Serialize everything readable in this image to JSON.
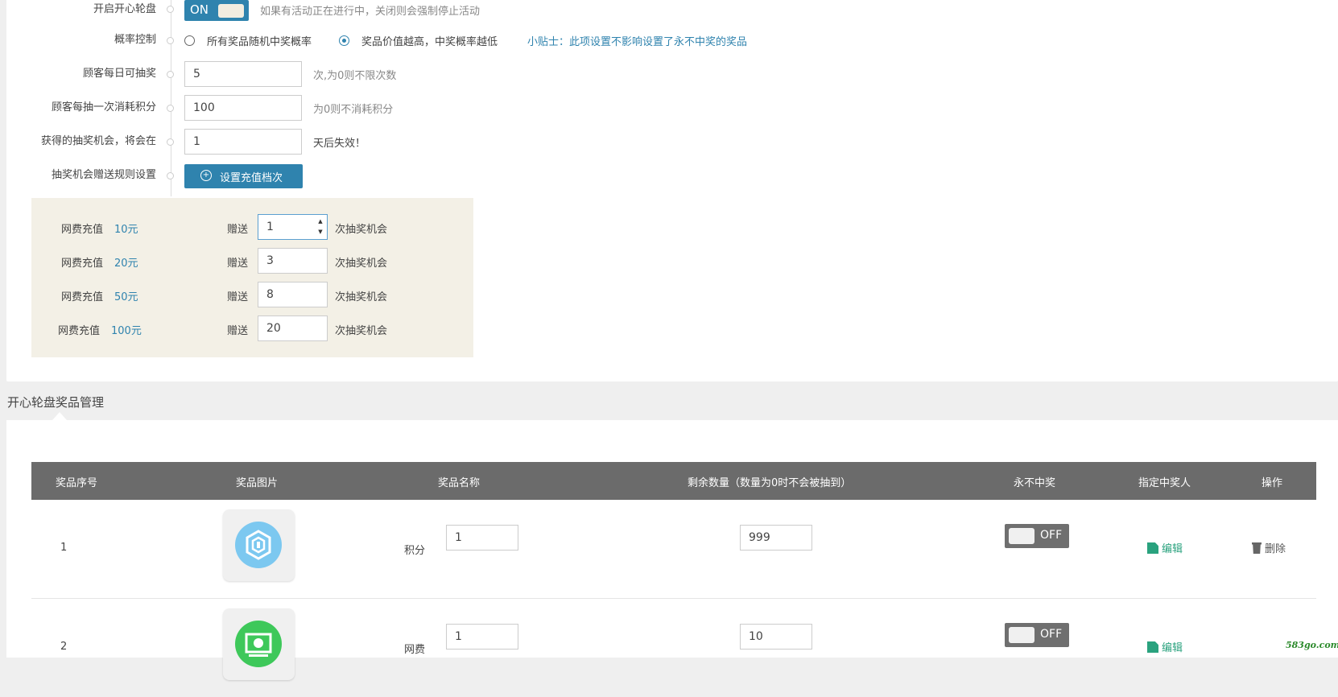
{
  "settings": {
    "toggle": {
      "label": "开启开心轮盘",
      "state": "ON",
      "hint": "如果有活动正在进行中，关闭则会强制停止活动"
    },
    "probability": {
      "label": "概率控制",
      "options": [
        "所有奖品随机中奖概率",
        "奖品价值越高，中奖概率越低"
      ],
      "selected_index": 1,
      "tip": "小贴士：此项设置不影响设置了永不中奖的奖品"
    },
    "daily_draws": {
      "label": "顾客每日可抽奖",
      "value": "5",
      "hint": "次,为0则不限次数"
    },
    "points_per_draw": {
      "label": "顾客每抽一次消耗积分",
      "value": "100",
      "hint": "为0则不消耗积分"
    },
    "expire_days": {
      "label": "获得的抽奖机会，将会在",
      "value": "1",
      "hint": "天后失效！"
    },
    "gift_rules": {
      "label": "抽奖机会赠送规则设置",
      "button": "设置充值档次"
    }
  },
  "recharge": {
    "prefix": "网费充值",
    "give": "赠送",
    "suffix": "次抽奖机会",
    "tiers": [
      {
        "amount": "10元",
        "count": "1"
      },
      {
        "amount": "20元",
        "count": "3"
      },
      {
        "amount": "50元",
        "count": "8"
      },
      {
        "amount": "100元",
        "count": "20"
      }
    ]
  },
  "prizes_section": {
    "title": "开心轮盘奖品管理",
    "columns": [
      "奖品序号",
      "奖品图片",
      "奖品名称",
      "剩余数量（数量为0时不会被抽到）",
      "永不中奖",
      "指定中奖人",
      "操作"
    ],
    "rows": [
      {
        "index": "1",
        "icon": "points-shield-icon",
        "icon_color": "#7cc8f0",
        "name_label": "积分",
        "name_value": "1",
        "quantity": "999",
        "never_win": "OFF",
        "edit": "编辑",
        "delete": "删除"
      },
      {
        "index": "2",
        "icon": "money-bill-icon",
        "icon_color": "#3ec85a",
        "name_label": "网费",
        "name_value": "1",
        "quantity": "10",
        "never_win": "OFF",
        "edit": "编辑"
      }
    ]
  },
  "watermark": "583go.com",
  "colors": {
    "accent": "#2f83ae",
    "edit": "#2aa27e",
    "header": "#6b6b6b",
    "recharge_bg": "#f3f0e6"
  }
}
